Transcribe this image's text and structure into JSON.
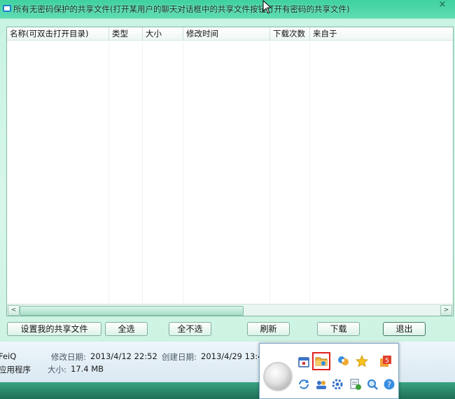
{
  "window": {
    "title": "所有无密码保护的共享文件(打开某用户的聊天对话框中的共享文件按钮打开有密码的共享文件)",
    "close_glyph": "×"
  },
  "list": {
    "columns": [
      "名称(可双击打开目录)",
      "类型",
      "大小",
      "修改时间",
      "下载次数",
      "来自于"
    ],
    "rows": []
  },
  "buttons": {
    "share": "设置我的共享文件",
    "select_all": "全选",
    "select_none": "全不选",
    "refresh": "刷新",
    "download": "下载",
    "exit": "退出"
  },
  "file_details": {
    "name": "FeiQ",
    "type": "应用程序",
    "modified_label": "修改日期:",
    "modified_value": "2013/4/12 22:52",
    "size_label": "大小:",
    "size_value": "17.4 MB",
    "created_label": "创建日期:",
    "created_value": "2013/4/29 13:4"
  },
  "tray_icons": [
    {
      "name": "calendar-icon"
    },
    {
      "name": "shared-folder-icon",
      "highlighted": true
    },
    {
      "name": "user-group-icon"
    },
    {
      "name": "star-icon"
    },
    {
      "name": "html5-icon"
    },
    {
      "name": "refresh-icon"
    },
    {
      "name": "contacts-icon"
    },
    {
      "name": "settings-icon"
    },
    {
      "name": "message-icon"
    },
    {
      "name": "search-icon"
    },
    {
      "name": "help-icon"
    }
  ],
  "colors": {
    "window_accent": "#3fd1a0",
    "highlight": "#e02020"
  }
}
